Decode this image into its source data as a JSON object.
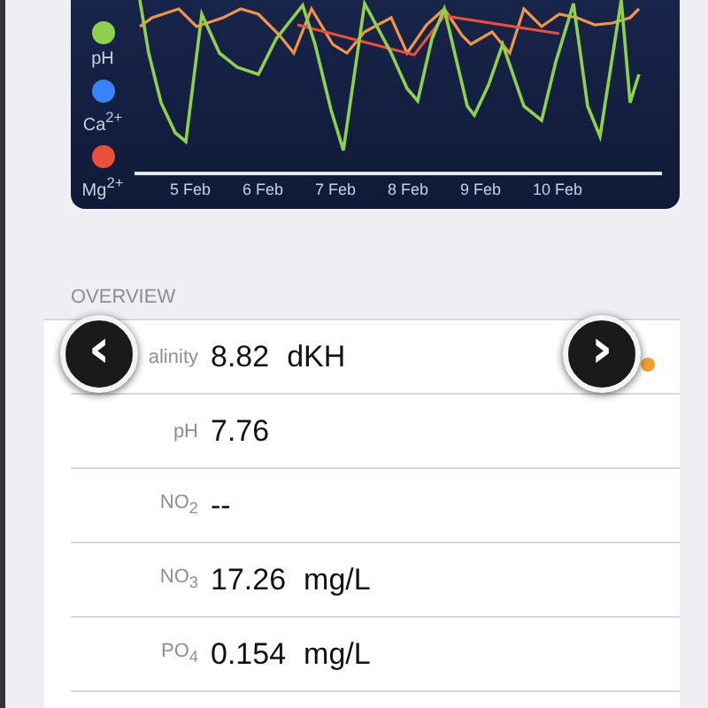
{
  "chart": {
    "legend": [
      {
        "label": "pH",
        "color": "#8fd14f"
      },
      {
        "label": "Ca$^{2+}$",
        "color": "#3a82f7"
      },
      {
        "label": "Mg$^{2+}$",
        "color": "#e8503a"
      }
    ],
    "dates": [
      "5 Feb",
      "6 Feb",
      "7 Feb",
      "8 Feb",
      "9 Feb",
      "10 Feb"
    ]
  },
  "overview": {
    "title": "OVERVIEW",
    "rows": [
      {
        "label": "alinity",
        "value": "8.82",
        "unit": "dKH"
      },
      {
        "label": "pH",
        "value": "7.76"
      },
      {
        "label": "NO$_{2}$",
        "value": "--"
      },
      {
        "label": "NO$_{3}$",
        "value": "17.26",
        "unit": "mg/L"
      },
      {
        "label": "PO$_{4}$",
        "value": "0.154",
        "unit": "mg/L"
      }
    ]
  },
  "nav": {
    "previous": "‹",
    "next": "›"
  }
}
